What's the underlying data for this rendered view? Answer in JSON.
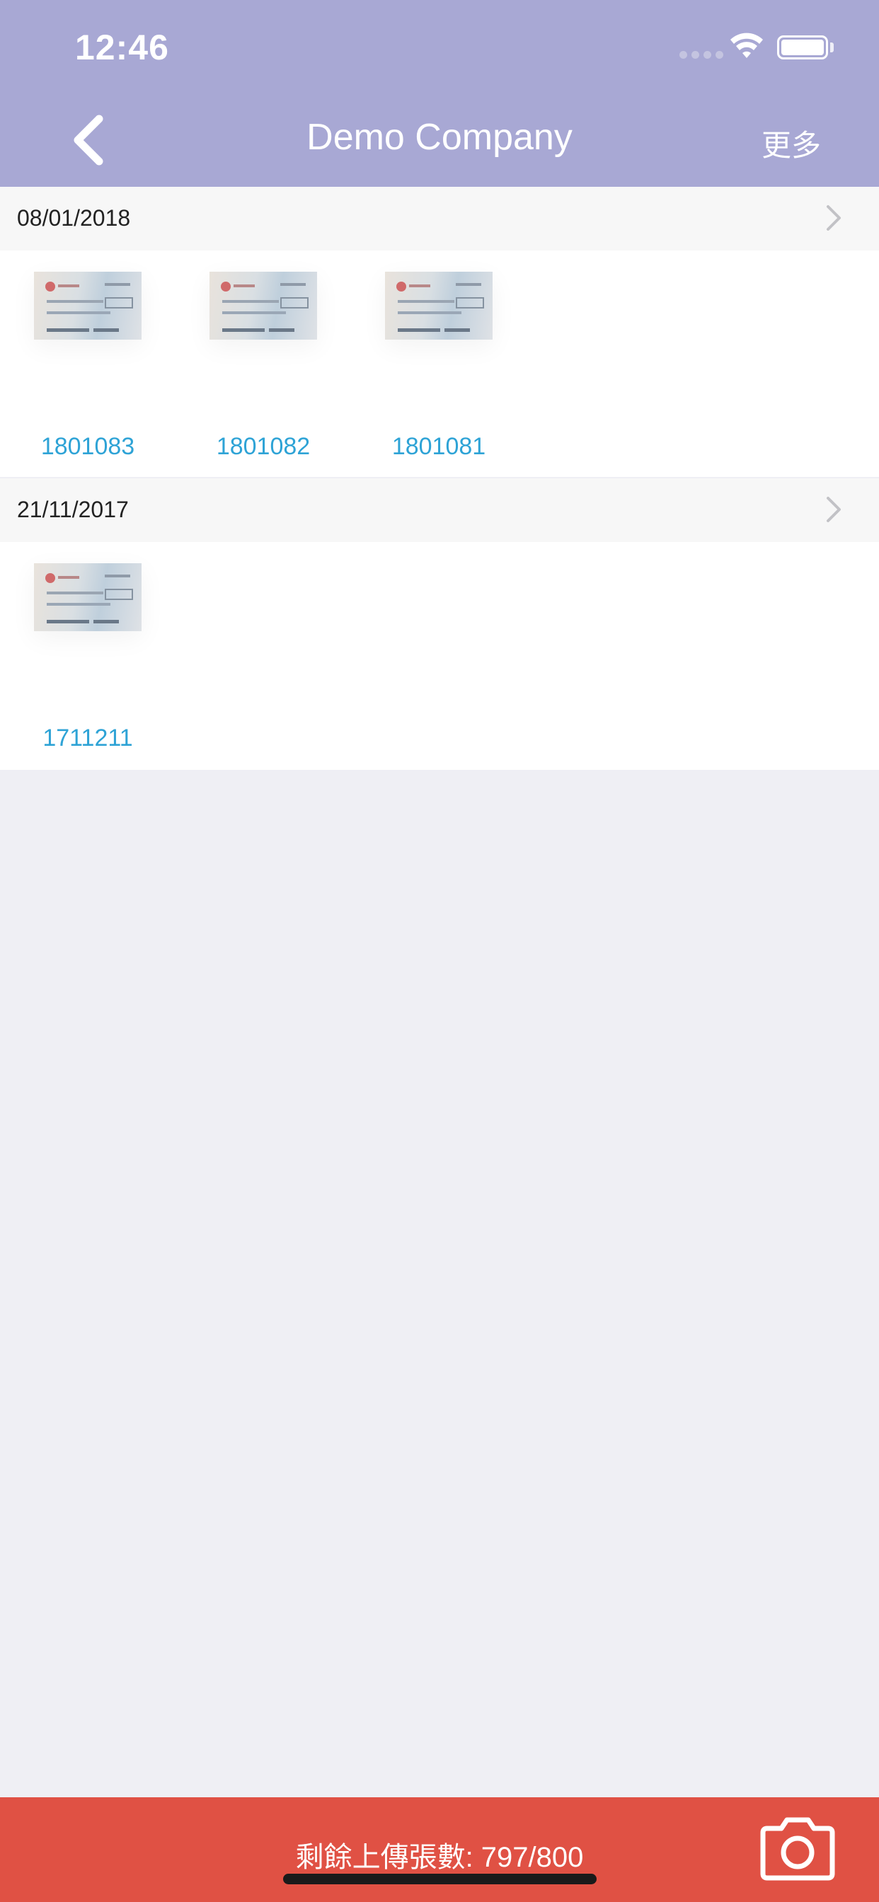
{
  "status_bar": {
    "time": "12:46"
  },
  "nav": {
    "title": "Demo Company",
    "more_label": "更多"
  },
  "sections": [
    {
      "date": "08/01/2018",
      "items": [
        {
          "label": "1801083"
        },
        {
          "label": "1801082"
        },
        {
          "label": "1801081"
        }
      ]
    },
    {
      "date": "21/11/2017",
      "items": [
        {
          "label": "1711211"
        }
      ]
    }
  ],
  "bottom_bar": {
    "quota_text": "剩餘上傳張數: 797/800"
  },
  "colors": {
    "nav_background": "#a8a8d4",
    "bottom_bar_background": "#e05144",
    "item_label": "#2ea3d6",
    "page_background": "#efeff4"
  },
  "icons": {
    "back": "chevron-left-icon",
    "section_arrow": "chevron-right-icon",
    "camera": "camera-icon",
    "wifi": "wifi-icon",
    "battery": "battery-icon"
  }
}
